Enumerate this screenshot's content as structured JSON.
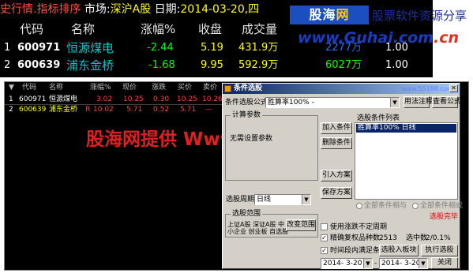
{
  "top": {
    "title_prefix": "史行情.指标排序",
    "market_label": "市场:",
    "market_value": "深沪A股",
    "date_label": "日期:",
    "date_value": "2014-03-20,四",
    "headers": [
      "代码",
      "名称",
      "涨幅%",
      "收盘",
      "成交量"
    ],
    "rows": [
      {
        "idx": "1",
        "code": "600971",
        "name": "恒源煤电",
        "chg": "-2.44",
        "close": "5.19",
        "vol": "431.9万",
        "vol2": "2277万",
        "last": "1.00"
      },
      {
        "idx": "2",
        "code": "600639",
        "name": "浦东金桥",
        "chg": "-1.68",
        "close": "9.95",
        "vol": "592.9万",
        "vol2": "6027万",
        "last": "1.00"
      }
    ]
  },
  "logo": {
    "badge_part1": "股海",
    "badge_part2": "网",
    "slogan": "股票软件资源分享",
    "url_part1": "www.Guhai.com",
    "url_part2": ".cn"
  },
  "grid": {
    "headers": [
      "▼",
      "代码",
      "名称",
      "涨幅%",
      "现价",
      "涨跌",
      "买价",
      "卖价"
    ],
    "rows": [
      {
        "idx": "1",
        "code": "600971",
        "name": "恒源煤电",
        "chg": "3.02",
        "price": "10.25",
        "diff": "0.30",
        "bid": "10.25",
        "ask": "10.26"
      },
      {
        "idx": "2",
        "code": "600639",
        "name": "浦东金桥",
        "flag": "R",
        "chg": "10.02",
        "price": "5.71",
        "diff": "0.52",
        "bid": "5.71",
        "ask": "—"
      }
    ]
  },
  "watermark": "股海网提供 Www.Guhai.Com.CN",
  "dialog": {
    "title": "条件选股",
    "title_url": "www.55188.com",
    "formula_label": "条件选股公式",
    "formula_value": "胜算率100% -",
    "btn_usage": "用法注释",
    "btn_view": "查看公式",
    "params_group": "计算参数",
    "params_note": "无需设置参数",
    "btn_add": "加入条件",
    "btn_delete": "删除条件",
    "btn_import": "引入方案",
    "btn_save": "保存方案",
    "cond_list_title": "选股条件列表",
    "cond_item": "胜算率100% 日线",
    "period_label": "选股周期:",
    "period_value": "日线",
    "radio_all": "全部条件相与",
    "radio_any": "全部条件相或",
    "done_text": "选股完毕",
    "range_group": "选股范围",
    "range_text_1": "上证A股 深证A股 中",
    "range_text_2": "小企业 创业板 自选股",
    "btn_change": "改变范围",
    "chk_future": "使用涨跌不定周期",
    "chk_adjust": "精确复权",
    "count_label": "品种数",
    "count_value": "2513",
    "selected_label": "选中数",
    "selected_value": "2/0.1%",
    "chk_period": "时间段内满足条件",
    "btn_to_block": "选股入板块",
    "btn_run": "执行选股",
    "date_from": "2014- 3-20",
    "date_to": "2014- 3-20",
    "btn_close": "关闭"
  }
}
